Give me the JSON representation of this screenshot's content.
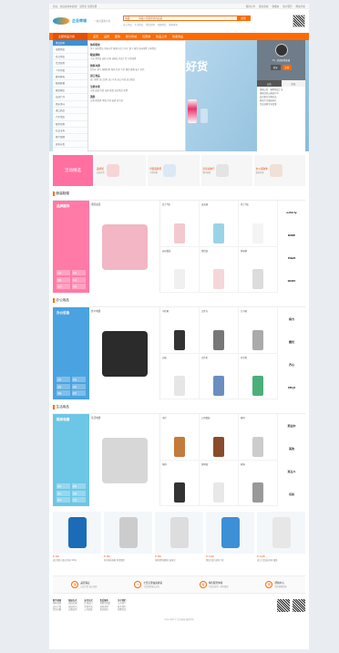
{
  "topbar": {
    "left": "您好，欢迎来到本商城！ 请登录 免费注册",
    "links": [
      "我的订单",
      "我的商城",
      "收藏夹",
      "客户服务",
      "网站导航"
    ]
  },
  "header": {
    "brand": "企业商城",
    "slogan": "一站式采购平台",
    "search_type": "商品",
    "search_placeholder": "请输入您要搜索的商品",
    "search_btn": "搜索",
    "hotwords": [
      "办公用品",
      "生活用品",
      "食品饮料",
      "母婴用品",
      "数码家电"
    ]
  },
  "nav": [
    "全部商品分类",
    "首页",
    "品牌",
    "团购",
    "积分商城",
    "优惠券",
    "新品上市",
    "热卖商品"
  ],
  "catmenu": [
    "食品饮料",
    "母婴用品",
    "办公用品",
    "生活日用",
    "个护美妆",
    "数码家电",
    "服装鞋帽",
    "家居家纺",
    "运动户外",
    "酒水茶叶",
    "进口商品",
    "汽车用品",
    "图书音像",
    "礼品卡券",
    "医疗保健",
    "更多分类"
  ],
  "subpanel": [
    {
      "h": "休闲零食",
      "l": "饼干 膨化食品 坚果炒货 糖果巧克力 肉干 果干 蜜饯 海味零食 方便食品"
    },
    {
      "h": "粮油调味",
      "l": "大米 食用油 面粉 杂粮 调味品 南北干货 方便速食"
    },
    {
      "h": "饮料冲调",
      "l": "饮用水 果汁 碳酸饮料 咖啡 奶茶 牛奶 酸奶 蜂蜜 麦片 茶饮"
    },
    {
      "h": "进口食品",
      "l": "进口零食 进口饮料 进口牛奶 进口冲调 进口粮油"
    },
    {
      "h": "生鲜水果",
      "l": "水果 蔬菜 肉类 海鲜 蛋类 速冻食品 熟食"
    },
    {
      "h": "酒类",
      "l": "白酒 葡萄酒 啤酒 洋酒 黄酒 养生酒"
    }
  ],
  "banner": {
    "text": "好货"
  },
  "userpanel": {
    "greet": "Hi，欢迎来到商城",
    "login": "登录",
    "register": "注册",
    "tabs": [
      "公告",
      "活动"
    ],
    "list": [
      "商城公告：春季新品上市",
      "满减活动火热进行中",
      "会员积分兑换礼品",
      "新用户注册送好礼",
      "企业采购专享优惠"
    ]
  },
  "promo": {
    "tag": "活动精选",
    "cells": [
      {
        "t": "品牌团",
        "s": "品质好货"
      },
      {
        "t": "母婴品牌周",
        "s": "大牌特惠"
      },
      {
        "t": "居家好物节",
        "s": "限时抢购"
      },
      {
        "t": "办公采购季",
        "s": "满减优惠"
      }
    ]
  },
  "floors": [
    {
      "title": "服装鞋帽",
      "left": "品牌服饰",
      "color": "#ff7aa6",
      "mid": "潮流女装",
      "grid": [
        "女士T恤",
        "连衣裙",
        "男士T恤",
        "运动套装",
        "情侣装",
        "休闲裤"
      ],
      "tags": [
        "女装",
        "男装",
        "童装",
        "内衣",
        "运动",
        "鞋靴"
      ],
      "brands": [
        "ochirly",
        "NIKE",
        "H&M",
        "ONLY"
      ]
    },
    {
      "title": "办公用品",
      "left": "办公设备",
      "color": "#4aa3e0",
      "mid": "办公电器",
      "grid": [
        "中性笔",
        "文件夹",
        "订书机",
        "白板",
        "文件柜",
        "打印纸"
      ],
      "tags": [
        "文具",
        "纸张",
        "设备",
        "耗材",
        "电脑",
        "配件"
      ],
      "brands": [
        "得力",
        "晨光",
        "齐心",
        "MUJI"
      ]
    },
    {
      "title": "生活用品",
      "left": "厨房电器",
      "color": "#6cc6e6",
      "mid": "生活电器",
      "grid": [
        "木铲",
        "刀具套装",
        "餐具",
        "锅具",
        "保鲜盒",
        "收纳"
      ],
      "tags": [
        "厨具",
        "餐具",
        "清洁",
        "收纳",
        "家电",
        "杂货"
      ],
      "brands": [
        "苏泊尔",
        "美的",
        "双立人",
        "乐扣"
      ]
    }
  ],
  "products": [
    {
      "price": "¥ 69",
      "desc": "进口婴幼儿配方奶粉 900g"
    },
    {
      "price": "¥ 89",
      "desc": "多功能收纳箱 家用整理"
    },
    {
      "price": "¥ 89",
      "desc": "加厚透明储物柜 抽屉式"
    },
    {
      "price": "¥ 109",
      "desc": "婴幼儿配方奶粉 3段"
    },
    {
      "price": "¥ 128",
      "desc": "进口儿童成长奶粉 罐装"
    }
  ],
  "services": [
    {
      "t1": "品质保证",
      "t2": "正品行货 放心购买"
    },
    {
      "t1": "七天无理由退换货",
      "t2": "为您提供售后无忧"
    },
    {
      "t1": "特色服务体验",
      "t2": "为您呈现不一样的服务"
    },
    {
      "t1": "帮助中心",
      "t2": "您的购物指南"
    }
  ],
  "footer": [
    {
      "h": "新手指南",
      "items": [
        "购物流程",
        "会员介绍",
        "常见问题"
      ]
    },
    {
      "h": "配送方式",
      "items": [
        "配送范围",
        "配送时间",
        "运费说明"
      ]
    },
    {
      "h": "支付方式",
      "items": [
        "在线支付",
        "货到付款",
        "公司转账"
      ]
    },
    {
      "h": "售后服务",
      "items": [
        "退换货政策",
        "退款说明",
        "投诉建议"
      ]
    },
    {
      "h": "关于我们",
      "items": [
        "公司简介",
        "联系我们",
        "招聘信息"
      ]
    }
  ],
  "copyright": "Copyright © 企业商城 版权所有"
}
